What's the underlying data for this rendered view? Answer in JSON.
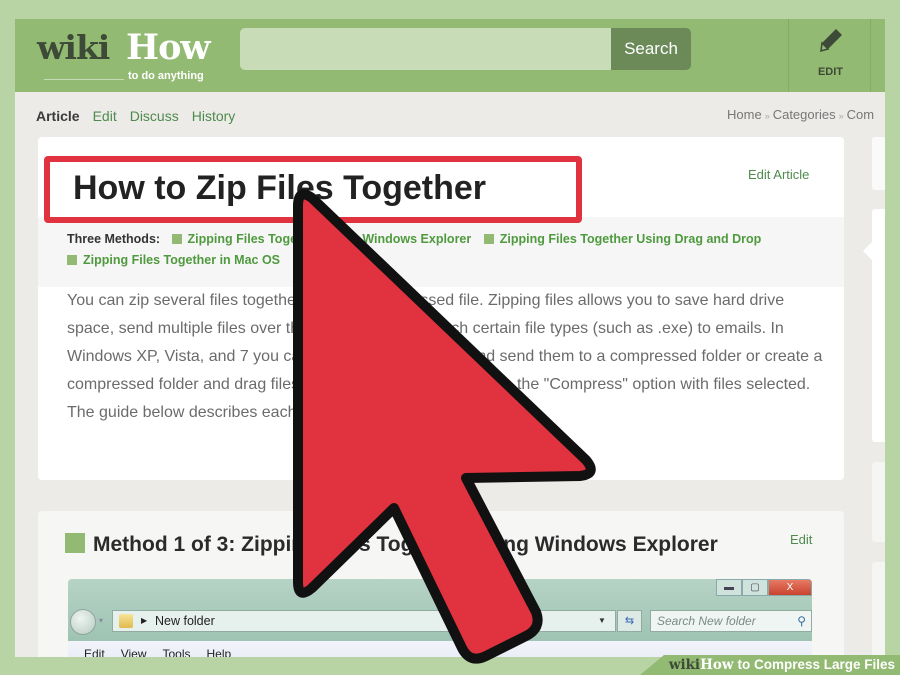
{
  "header": {
    "logo_wiki": "wiki",
    "logo_how": "How",
    "logo_tagline": "to do anything",
    "search_placeholder": "",
    "search_button": "Search",
    "edit_tab_icon": "pencil-icon",
    "edit_tab_label": "EDIT"
  },
  "nav": {
    "tabs": [
      {
        "label": "Article",
        "active": true
      },
      {
        "label": "Edit",
        "active": false
      },
      {
        "label": "Discuss",
        "active": false
      },
      {
        "label": "History",
        "active": false
      }
    ],
    "breadcrumb": [
      "Home",
      "Categories",
      "Com"
    ],
    "breadcrumb_separator": "»"
  },
  "article": {
    "title": "How to Zip Files Together",
    "edit_article": "Edit Article",
    "methods_label": "Three Methods:",
    "methods": [
      "Zipping Files Together Using Windows Explorer",
      "Zipping Files Together Using Drag and Drop",
      "Zipping Files Together in Mac OS"
    ],
    "intro": "You can zip several files together into one compressed file. Zipping files allows you to save hard drive space, send multiple files over the Internet, and to attach certain file types (such as .exe) to emails. In Windows XP, Vista, and 7 you can either select each file and send them to a compressed folder or create a compressed folder and drag files to it. With Mac OS X, you use the \"Compress\" option with files selected. The guide below describes each of these methods."
  },
  "method1": {
    "heading": "Method 1 of 3: Zipping Files Together Using Windows Explorer",
    "edit": "Edit",
    "explorer": {
      "address": "New folder",
      "search_placeholder": "Search New folder",
      "window_buttons": [
        "minimize",
        "maximize",
        "close"
      ],
      "close_glyph": "X",
      "menu": [
        "Edit",
        "View",
        "Tools",
        "Help"
      ]
    }
  },
  "overlay": {
    "cursor_icon": "red-arrow-cursor-icon",
    "cursor_color": "#e0323f",
    "highlight_color": "#e0323f"
  },
  "footer_banner": {
    "wiki": "wiki",
    "how": "How",
    "text": "to Compress Large Files"
  },
  "colors": {
    "brand_green": "#93ba73",
    "link_green": "#4f8a4d",
    "search_button": "#6b8a58",
    "page_bg": "#ecebe8",
    "frame": "#b8d3a4"
  }
}
